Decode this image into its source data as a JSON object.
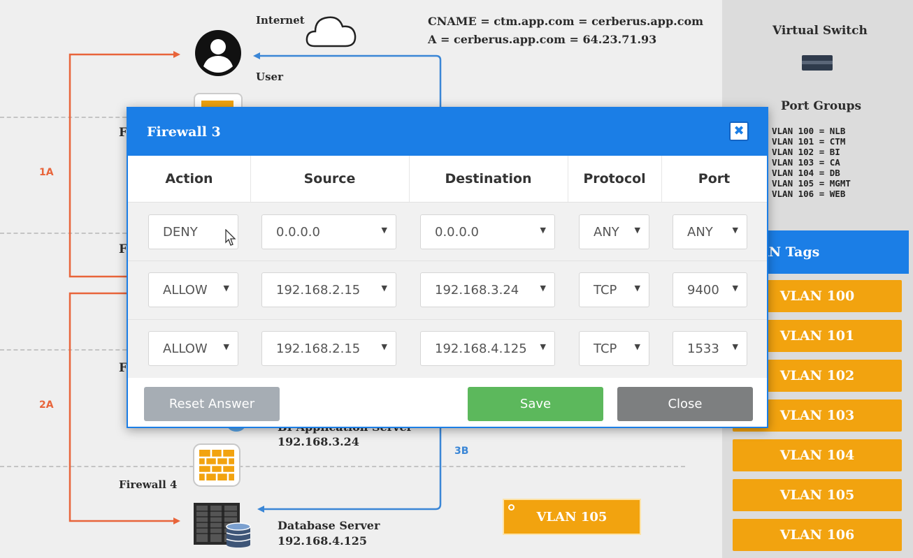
{
  "diagram": {
    "internet_label": "Internet",
    "user_label": "User",
    "dns_line1": "CNAME = ctm.app.com = cerberus.app.com",
    "dns_line2": "A = cerberus.app.com = 64.23.71.93",
    "path_1a": "1A",
    "path_2a": "2A",
    "path_3b": "3B",
    "fw_partial_1": "F",
    "fw_partial_2": "F",
    "fw_partial_3": "F",
    "bi_server_name": "BI Application Server",
    "bi_server_ip": "192.168.3.24",
    "firewall4_label": "Firewall 4",
    "db_server_name": "Database Server",
    "db_server_ip": "192.168.4.125",
    "dropped_vlan": "VLAN 105"
  },
  "right_panel": {
    "virtual_switch_label": "Virtual Switch",
    "port_groups_label": "Port Groups",
    "port_groups": [
      "VLAN 100 = NLB",
      "VLAN 101 = CTM",
      "VLAN 102 = BI",
      "VLAN 103 = CA",
      "VLAN 104 = DB",
      "VLAN 105 = MGMT",
      "VLAN 106 = WEB"
    ],
    "vlan_tags_label": "AN Tags",
    "vlan_tags": [
      "VLAN 100",
      "VLAN 101",
      "VLAN 102",
      "VLAN 103",
      "VLAN 104",
      "VLAN 105",
      "VLAN 106"
    ]
  },
  "modal": {
    "title": "Firewall 3",
    "close_glyph": "✖",
    "columns": [
      "Action",
      "Source",
      "Destination",
      "Protocol",
      "Port"
    ],
    "rows": [
      {
        "action": "DENY",
        "source": "0.0.0.0",
        "destination": "0.0.0.0",
        "protocol": "ANY",
        "port": "ANY"
      },
      {
        "action": "ALLOW",
        "source": "192.168.2.15",
        "destination": "192.168.3.24",
        "protocol": "TCP",
        "port": "9400"
      },
      {
        "action": "ALLOW",
        "source": "192.168.2.15",
        "destination": "192.168.4.125",
        "protocol": "TCP",
        "port": "1533"
      }
    ],
    "reset_label": "Reset Answer",
    "save_label": "Save",
    "close_label": "Close"
  },
  "colors": {
    "accent_blue": "#1b7ee6",
    "vlan_orange": "#f2a30f",
    "arrow_orange": "#e8643a",
    "arrow_blue": "#3a86d6",
    "save_green": "#5cb85c",
    "close_gray": "#7d7f80",
    "reset_gray": "#a6adb4"
  },
  "icons": [
    "cloud-icon",
    "user-icon",
    "firewall-icon",
    "server-icon",
    "database-icon",
    "switch-icon",
    "close-icon",
    "cursor-icon"
  ]
}
